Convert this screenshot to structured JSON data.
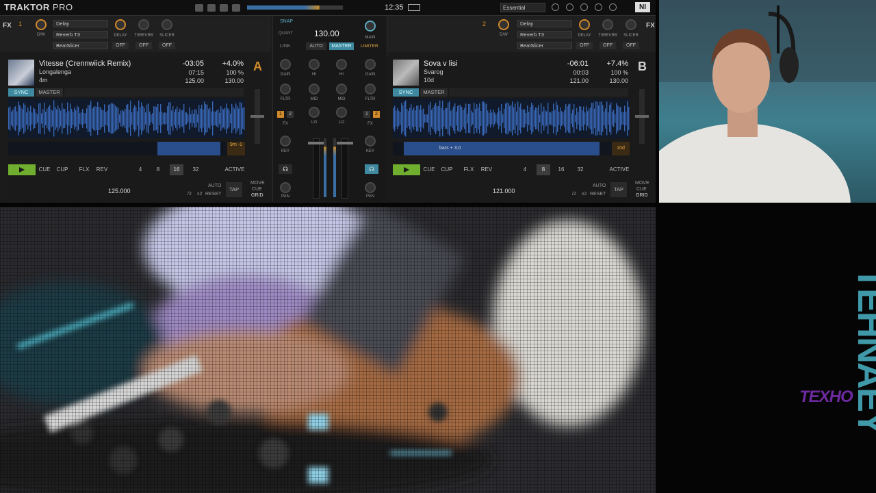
{
  "app": {
    "logo_bold": "TRAKTOR",
    "logo_light": " PRO",
    "clock": "12:35",
    "layout": "Essential",
    "ni": "NI"
  },
  "fx_left": {
    "label": "FX",
    "unit": "1",
    "dw": "D/W",
    "slots": [
      "Delay",
      "Reverb T3",
      "BeatSlicer"
    ],
    "knob_labels": [
      "DELAY",
      "T3REVRB",
      "SLICER"
    ],
    "buttons": [
      "OFF",
      "OFF",
      "OFF"
    ]
  },
  "fx_right": {
    "label": "FX",
    "unit": "2",
    "dw": "D/W",
    "slots": [
      "Delay",
      "Reverb T3",
      "BeatSlicer"
    ],
    "knob_labels": [
      "DELAY",
      "T3REVRB",
      "SLICER"
    ],
    "buttons": [
      "OFF",
      "OFF",
      "OFF"
    ]
  },
  "deck_a": {
    "letter": "A",
    "title": "Vitesse (Crennwiick Remix)",
    "artist": "Longalenga",
    "key": "4m",
    "remaining": "-03:05",
    "elapsed": "07:15",
    "bpm_track": "125.00",
    "pitch": "+4.0%",
    "pitch_pct": "100 %",
    "bpm_live": "130.00",
    "sync": "SYNC",
    "master": "MASTER",
    "loop_badge": "9m\n-1",
    "transport": {
      "cue": "CUE",
      "cup": "CUP",
      "flx": "FLX",
      "rev": "REV",
      "sizes": [
        "4",
        "8",
        "16",
        "32"
      ],
      "active_size": "16",
      "active": "ACTIVE"
    },
    "bottom": {
      "bpm": "125.000",
      "half": "/2",
      "double": "x2",
      "auto": "AUTO",
      "reset": "RESET",
      "tap": "TAP",
      "move": "MOVE",
      "cue": "CUE",
      "grid": "GRID"
    },
    "color": "#d28a2a"
  },
  "deck_b": {
    "letter": "B",
    "title": "Sova v lisi",
    "artist": "Svarog",
    "key": "10d",
    "remaining": "-06:01",
    "elapsed": "00:03",
    "bpm_track": "121.00",
    "pitch": "+7.4%",
    "pitch_pct": "100 %",
    "bpm_live": "130.00",
    "sync": "SYNC",
    "master": "MASTER",
    "loop_badge": "10d",
    "strip_label": "bars + 3.0",
    "transport": {
      "cue": "CUE",
      "cup": "CUP",
      "flx": "FLX",
      "rev": "REV",
      "sizes": [
        "4",
        "8",
        "16",
        "32"
      ],
      "active_size": "8",
      "active": "ACTIVE"
    },
    "bottom": {
      "bpm": "121.000",
      "half": "/2",
      "double": "x2",
      "auto": "AUTO",
      "reset": "RESET",
      "tap": "TAP",
      "move": "MOVE",
      "cue": "CUE",
      "grid": "GRID"
    },
    "color": "#cfcfcf"
  },
  "mixer": {
    "snap": "SNAP",
    "quant": "QUANT",
    "bpm": "130.00",
    "link": "LINK",
    "auto": "AUTO",
    "master": "MASTER",
    "main": "MAIN",
    "limiter": "LIMITER",
    "labels": {
      "gain": "GAIN",
      "hi": "HI",
      "mid": "MID",
      "lo": "LO",
      "fltr": "FLTR",
      "fx": "FX",
      "key": "KEY",
      "pan": "PAN"
    },
    "fx_assign": [
      "1",
      "2"
    ]
  },
  "branding": {
    "vertical": "TEHNAEY",
    "texho": "TEXHO"
  }
}
